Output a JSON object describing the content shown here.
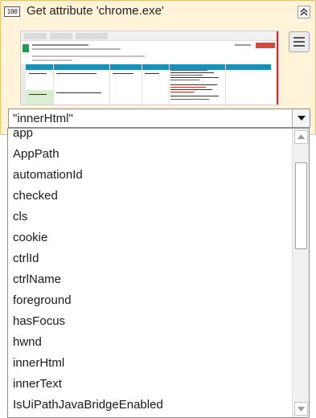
{
  "activity": {
    "icon_text": "100",
    "title": "Get attribute 'chrome.exe'"
  },
  "colors": {
    "activity_background": "#fff4d9",
    "activity_border": "#e6c46b"
  },
  "icons": {
    "activity": "activity-icon",
    "collapse": "chevron-double-up-icon",
    "menu": "hamburger-icon",
    "dropdown": "triangle-down-icon",
    "scroll_up": "triangle-up-icon",
    "scroll_down": "triangle-down-icon"
  },
  "combo": {
    "selected_value": "\"innerHtml\""
  },
  "dropdown": {
    "items": [
      "app",
      "AppPath",
      "automationId",
      "checked",
      "cls",
      "cookie",
      "ctrlId",
      "ctrlName",
      "foreground",
      "hasFocus",
      "hwnd",
      "innerHtml",
      "innerText",
      "IsUiPathJavaBridgeEnabled"
    ]
  }
}
